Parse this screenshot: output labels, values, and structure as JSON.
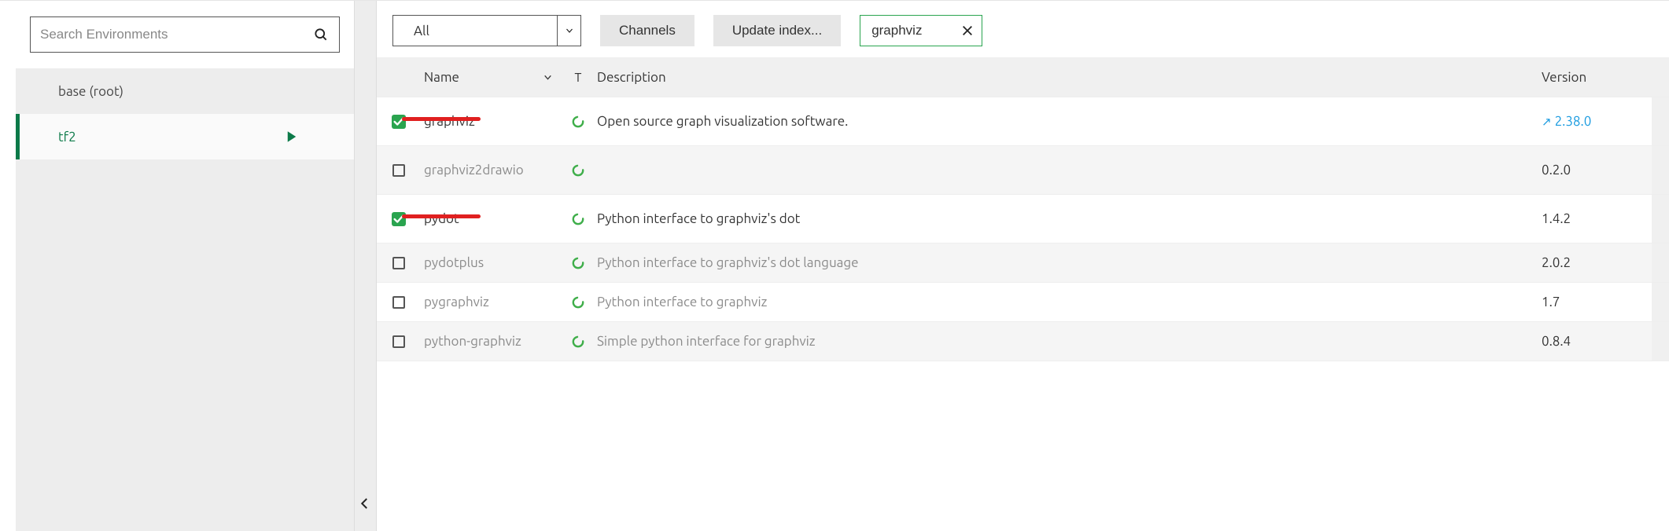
{
  "sidebar": {
    "search_placeholder": "Search Environments",
    "items": [
      {
        "label": "base (root)",
        "selected": false
      },
      {
        "label": "tf2",
        "selected": true
      }
    ]
  },
  "toolbar": {
    "filter_label": "All",
    "channels_label": "Channels",
    "update_index_label": "Update index...",
    "search_value": "graphviz"
  },
  "table": {
    "headers": {
      "name": "Name",
      "t": "T",
      "description": "Description",
      "version": "Version"
    },
    "rows": [
      {
        "checked": true,
        "name": "graphviz",
        "desc": "Open source graph visualization software.",
        "version": "2.38.0",
        "version_link": true,
        "muted": false,
        "underline": true
      },
      {
        "checked": false,
        "name": "graphviz2drawio",
        "desc": "",
        "version": "0.2.0",
        "version_link": false,
        "muted": true,
        "underline": false
      },
      {
        "checked": true,
        "name": "pydot",
        "desc": "Python interface to graphviz's dot",
        "version": "1.4.2",
        "version_link": false,
        "muted": false,
        "underline": true
      },
      {
        "checked": false,
        "name": "pydotplus",
        "desc": "Python interface to graphviz's dot language",
        "version": "2.0.2",
        "version_link": false,
        "muted": true,
        "underline": false
      },
      {
        "checked": false,
        "name": "pygraphviz",
        "desc": "Python interface to graphviz",
        "version": "1.7",
        "version_link": false,
        "muted": true,
        "underline": false
      },
      {
        "checked": false,
        "name": "python-graphviz",
        "desc": "Simple python interface for graphviz",
        "version": "0.8.4",
        "version_link": false,
        "muted": true,
        "underline": false
      }
    ]
  }
}
